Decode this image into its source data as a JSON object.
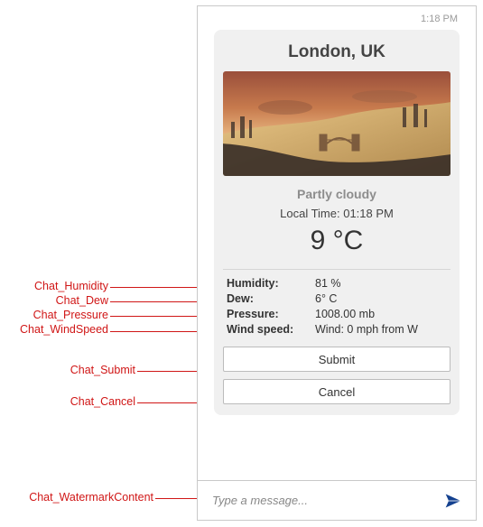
{
  "timestamp": "1:18 PM",
  "card": {
    "title": "London, UK",
    "condition": "Partly cloudy",
    "local_time_label": "Local Time: 01:18 PM",
    "temperature": "9 °C",
    "rows": {
      "humidity": {
        "label": "Humidity:",
        "value": "81 %"
      },
      "dew": {
        "label": "Dew:",
        "value": "6° C"
      },
      "pressure": {
        "label": "Pressure:",
        "value": "1008.00 mb"
      },
      "wind": {
        "label": "Wind speed:",
        "value": "Wind: 0 mph from W"
      }
    },
    "buttons": {
      "submit": "Submit",
      "cancel": "Cancel"
    }
  },
  "input": {
    "placeholder": "Type a message..."
  },
  "labels": {
    "humidity": "Chat_Humidity",
    "dew": "Chat_Dew",
    "pressure": "Chat_Pressure",
    "wind": "Chat_WindSpeed",
    "submit": "Chat_Submit",
    "cancel": "Chat_Cancel",
    "watermark": "Chat_WatermarkContent"
  }
}
